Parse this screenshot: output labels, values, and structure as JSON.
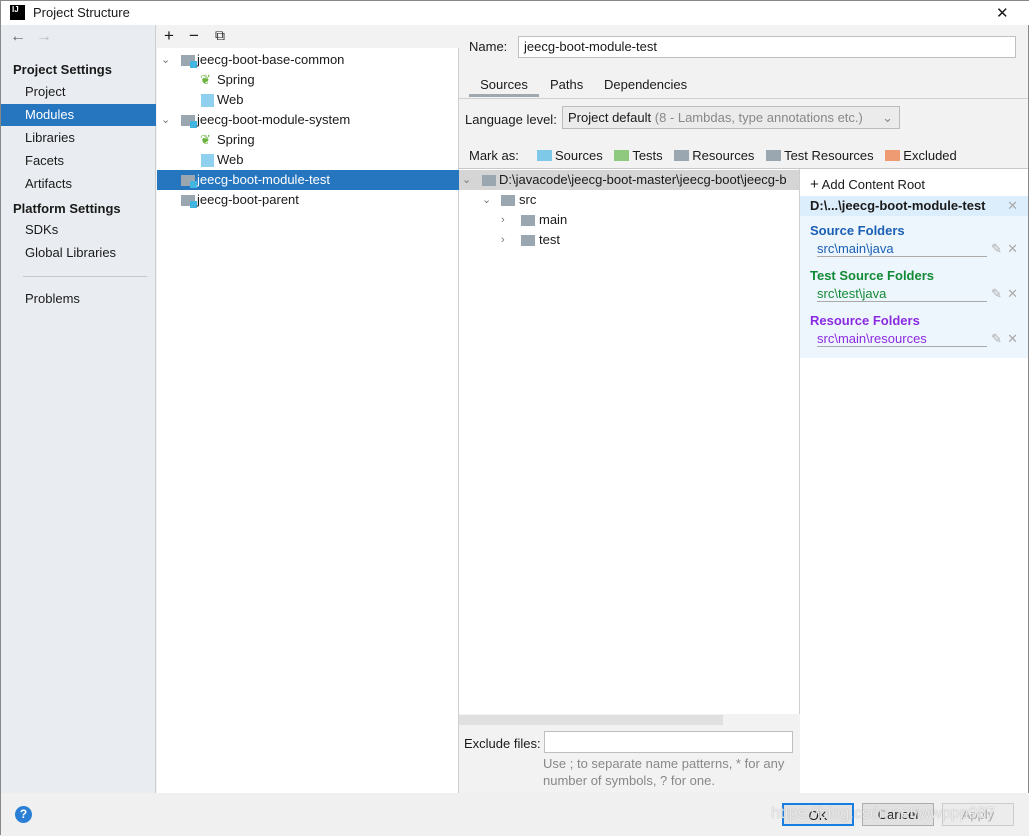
{
  "window": {
    "title": "Project Structure",
    "close": "✕"
  },
  "nav": {
    "back": "←",
    "forward": "→"
  },
  "sidebar": {
    "project_settings": "Project Settings",
    "items1": [
      "Project",
      "Modules",
      "Libraries",
      "Facets",
      "Artifacts"
    ],
    "platform_settings": "Platform Settings",
    "items2": [
      "SDKs",
      "Global Libraries"
    ],
    "problems": "Problems"
  },
  "modules_toolbar": {
    "add": "+",
    "remove": "−",
    "copy": "⧉"
  },
  "modules": [
    {
      "label": "jeecg-boot-base-common"
    },
    {
      "label": "Spring"
    },
    {
      "label": "Web"
    },
    {
      "label": "jeecg-boot-module-system"
    },
    {
      "label": "Spring"
    },
    {
      "label": "Web"
    },
    {
      "label": "jeecg-boot-module-test"
    },
    {
      "label": "jeecg-boot-parent"
    }
  ],
  "name": {
    "label": "Name:",
    "value": "jeecg-boot-module-test"
  },
  "tabs": [
    "Sources",
    "Paths",
    "Dependencies"
  ],
  "language": {
    "label": "Language level:",
    "value": "Project default",
    "hint": "(8 - Lambdas, type annotations etc.)"
  },
  "mark_as": {
    "label": "Mark as:",
    "items": [
      "Sources",
      "Tests",
      "Resources",
      "Test Resources",
      "Excluded"
    ],
    "colors": [
      "#7ec8e8",
      "#8fc97f",
      "#9aa7b0",
      "#9aa7b0",
      "#ee9a72"
    ]
  },
  "content_tree": {
    "root": "D:\\javacode\\jeecg-boot-master\\jeecg-boot\\jeecg-b",
    "src": "src",
    "main": "main",
    "test": "test"
  },
  "right_panel": {
    "add_root": "Add Content Root",
    "root_path": "D:\\...\\jeecg-boot-module-test",
    "source_title": "Source Folders",
    "source_path": "src\\main\\java",
    "test_title": "Test Source Folders",
    "test_path": "src\\test\\java",
    "res_title": "Resource Folders",
    "res_path": "src\\main\\resources",
    "colors": {
      "source": "#1a5fb4",
      "test": "#138a36",
      "res": "#8a2be2"
    }
  },
  "exclude": {
    "label": "Exclude files:",
    "value": "",
    "hint1": "Use ; to separate name patterns, * for any",
    "hint2": "number of symbols, ? for one."
  },
  "buttons": {
    "help": "?",
    "ok": "OK",
    "cancel": "Cancel",
    "apply": "Apply"
  },
  "watermark": "https://blog.csdn.net/wwppp987"
}
